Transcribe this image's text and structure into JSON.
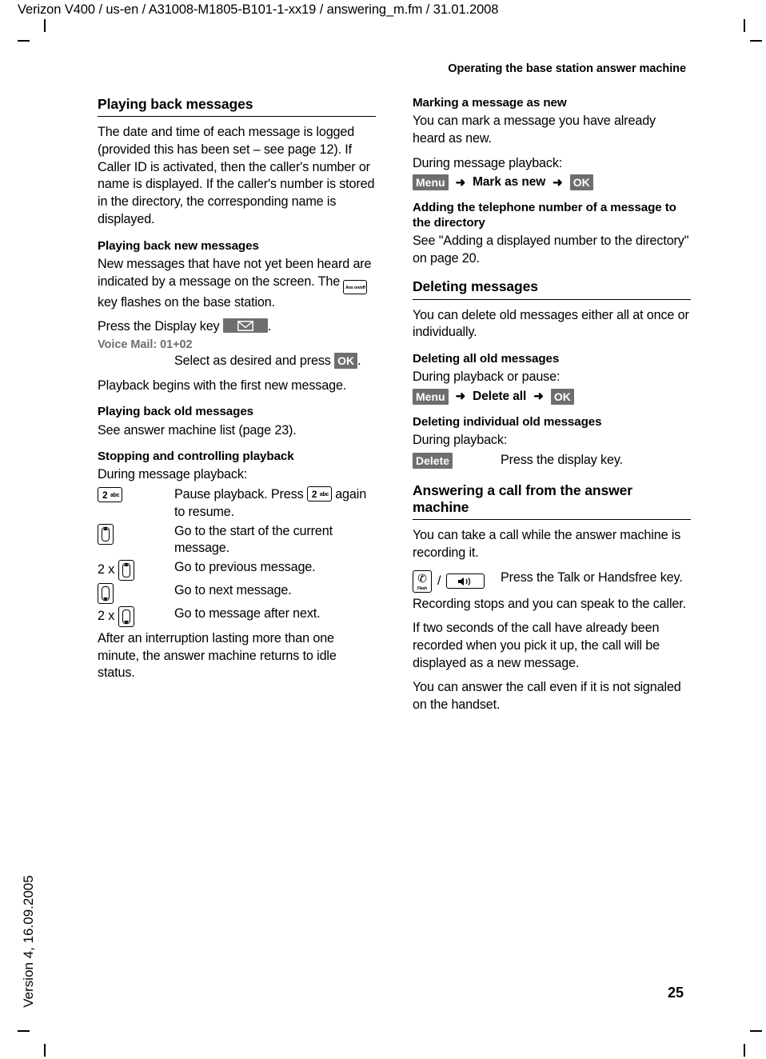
{
  "header": {
    "doc_path": "Verizon V400 / us-en / A31008-M1805-B101-1-xx19 / answering_m.fm / 31.01.2008",
    "chapter": "Operating the base station answer machine"
  },
  "footer": {
    "page_number": "25",
    "version_side_text": "Version 4, 16.09.2005"
  },
  "colors": {
    "softkey_background": "#6e6e6e",
    "softkey_text": "#ffffff",
    "grey_label_text": "#6e6e6e",
    "rule": "#000000"
  },
  "left_column": {
    "section_title": "Playing back messages",
    "intro": "The date and time of each message is logged (provided this has been set – see page 12). If Caller ID is activated, then the caller's number or name is displayed. If the caller's number is stored in the directory, the corresponding name is displayed.",
    "sub_new": {
      "title": "Playing back new messages",
      "para_1a": "New messages that have not yet been heard are indicated by a message on the screen. The ",
      "ans_key_label": "Ans on/off",
      "para_1b": " key flashes on the base station.",
      "press_display_key_a": "Press the Display key ",
      "press_display_key_b": ".",
      "voice_mail_label": "Voice Mail: 01+02",
      "select_line_a": "Select as desired and press ",
      "ok_label": "OK",
      "select_line_b": ".",
      "playback_begins": "Playback begins with the first new message."
    },
    "sub_old": {
      "title": "Playing back old messages",
      "body": "See answer machine list (page 23)."
    },
    "sub_stopping": {
      "title": "Stopping and controlling playback",
      "lead": "During message playback:",
      "rows": [
        {
          "cue_prefix": "",
          "cue_icon": "key-2-abc",
          "desc_a": "Pause playback. Press ",
          "desc_icon": "key-2-abc",
          "desc_b": " again to resume."
        },
        {
          "cue_prefix": "",
          "cue_icon": "nav-up-key",
          "desc_a": "Go to the start of the current message.",
          "desc_icon": "",
          "desc_b": ""
        },
        {
          "cue_prefix": "2 x",
          "cue_icon": "nav-up-key",
          "desc_a": "Go to previous message.",
          "desc_icon": "",
          "desc_b": ""
        },
        {
          "cue_prefix": "",
          "cue_icon": "nav-down-key",
          "desc_a": "Go to next message.",
          "desc_icon": "",
          "desc_b": ""
        },
        {
          "cue_prefix": "2 x",
          "cue_icon": "nav-down-key",
          "desc_a": "Go to message after next.",
          "desc_icon": "",
          "desc_b": ""
        }
      ],
      "closing": "After an interruption lasting more than one minute, the answer machine returns to idle status."
    }
  },
  "right_column": {
    "sub_marking": {
      "title": "Marking a message as new",
      "body": "You can mark a message you have already heard as new.",
      "lead": "During message playback:",
      "path": {
        "menu_label": "Menu",
        "arrow": "➜",
        "middle_label": "Mark as  new",
        "ok_label": "OK"
      }
    },
    "sub_adding": {
      "title": "Adding the telephone number of a message to the directory",
      "body": "See \"Adding a displayed number to the directory\" on page 20."
    },
    "section_deleting": {
      "title": "Deleting messages",
      "body": "You can delete old messages either all at once or individually."
    },
    "sub_delete_all": {
      "title": "Deleting all old messages",
      "lead": "During playback or pause:",
      "path": {
        "menu_label": "Menu",
        "arrow": "➜",
        "middle_label": "Delete all",
        "ok_label": "OK"
      }
    },
    "sub_delete_individual": {
      "title": "Deleting individual old messages",
      "lead": "During playback:",
      "row": {
        "delete_label": "Delete",
        "desc": "Press the display key."
      }
    },
    "section_answering": {
      "title": "Answering a call from the answer machine",
      "body_1": "You can take a call while the answer machine is recording it.",
      "row": {
        "talk_key_label": "Flash",
        "separator": "/",
        "desc": "Press the Talk or Handsfree key."
      },
      "body_2": "Recording stops and you can speak to the caller.",
      "body_3": "If two seconds of the call have already been recorded when you pick it up, the call will be displayed as a new message.",
      "body_4": "You can answer the call even if it is not signaled on the handset."
    }
  }
}
